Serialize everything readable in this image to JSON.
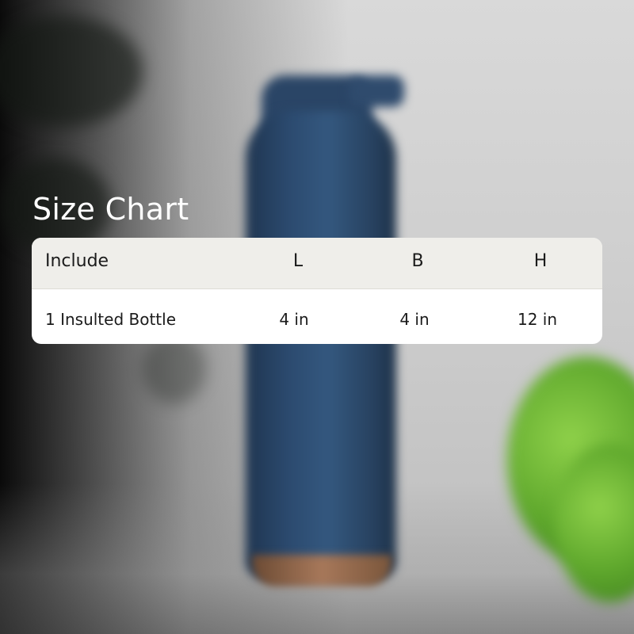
{
  "title": "Size Chart",
  "size_table": {
    "headers": [
      "Include",
      "L",
      "B",
      "H"
    ],
    "rows": [
      [
        "1 Insulted Bottle",
        "4 in",
        "4 in",
        "12 in"
      ]
    ]
  },
  "background": {
    "subject": "blue insulated bottle",
    "palette": {
      "bottle_blue": "#2c4b70",
      "plant_green": "#5ea72c",
      "wall_gray": "#d0d0d0",
      "vignette": "#000000"
    }
  }
}
